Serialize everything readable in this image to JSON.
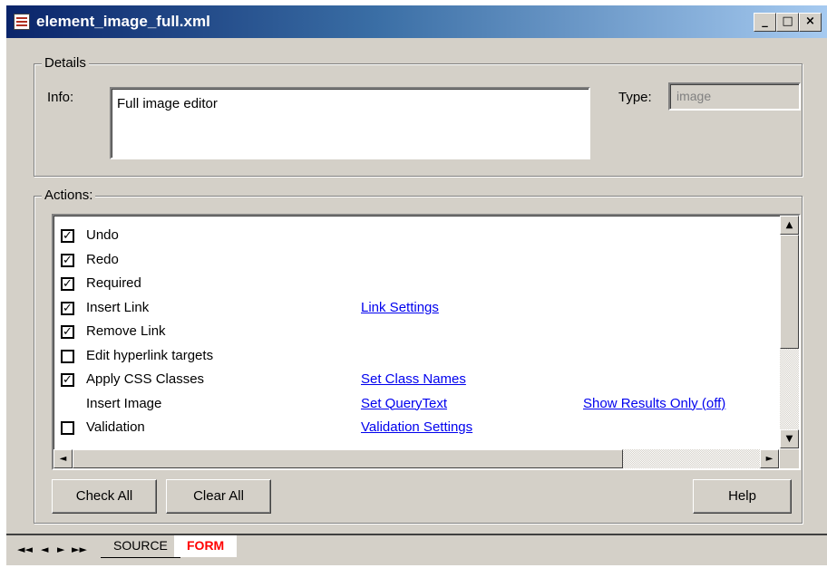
{
  "window": {
    "title": "element_image_full.xml",
    "minimize": "_",
    "maximize": "□",
    "close": "×"
  },
  "details": {
    "legend": "Details",
    "info_label": "Info:",
    "info_value": "Full image editor",
    "type_label": "Type:",
    "type_value": "image"
  },
  "actions": {
    "legend": "Actions:",
    "rows": [
      {
        "label": "Undo",
        "checkbox": true,
        "checked": true,
        "link1": "",
        "link2": ""
      },
      {
        "label": "Redo",
        "checkbox": true,
        "checked": true,
        "link1": "",
        "link2": ""
      },
      {
        "label": "Required",
        "checkbox": true,
        "checked": true,
        "link1": "",
        "link2": ""
      },
      {
        "label": "Insert Link",
        "checkbox": true,
        "checked": true,
        "link1": "Link Settings",
        "link2": ""
      },
      {
        "label": "Remove Link",
        "checkbox": true,
        "checked": true,
        "link1": "",
        "link2": ""
      },
      {
        "label": "Edit hyperlink targets",
        "checkbox": true,
        "checked": false,
        "link1": "",
        "link2": ""
      },
      {
        "label": "Apply CSS Classes",
        "checkbox": true,
        "checked": true,
        "link1": "Set Class Names",
        "link2": ""
      },
      {
        "label": "Insert Image",
        "checkbox": false,
        "checked": false,
        "link1": "Set QueryText",
        "link2": "Show Results Only (off)"
      },
      {
        "label": "Validation",
        "checkbox": true,
        "checked": false,
        "link1": "Validation Settings",
        "link2": ""
      }
    ]
  },
  "buttons": {
    "check_all": "Check All",
    "clear_all": "Clear All",
    "help": "Help"
  },
  "tabs": {
    "nav": [
      "◄◄",
      "◄",
      "►",
      "►►"
    ],
    "source": "SOURCE",
    "form": "FORM"
  }
}
